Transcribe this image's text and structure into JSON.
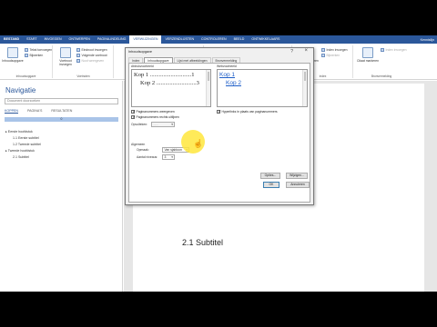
{
  "ribbon": {
    "tabs": [
      "BESTAND",
      "START",
      "INVOEGEN",
      "ONTWERPEN",
      "PAGINA-INDELING",
      "VERWIJZINGEN",
      "VERZENDLIJSTEN",
      "CONTROLEREN",
      "BEELD",
      "ONTWIKKELAARS"
    ],
    "active_tab": "VERWIJZINGEN",
    "user": "Kennislijn",
    "groups": {
      "toc": {
        "big": "Inhoudsopgave",
        "small": [
          "Tekst toevoegen",
          "Bijwerken"
        ],
        "label": "Inhoudsopgave"
      },
      "footnotes": {
        "big": "Voetnoot invoegen",
        "small": [
          "Eindnoot invoegen",
          "Volgende voetnoot",
          "Noot weergeven"
        ],
        "label": "Voetnoten"
      },
      "citations": {
        "big": "Citaat invoegen",
        "small": [
          "Bronnen beheren",
          "Stijl: APA",
          "Bibliografie"
        ],
        "label": "Citaten en bibliografie"
      },
      "captions": {
        "big": "Bijschrift invoegen",
        "small": [
          "Lijst met afbeeldingen invoegen",
          "Bijwerken",
          "Kruisverwijzing"
        ],
        "label": "Bijschriften"
      },
      "index": {
        "big": "Item markeren",
        "small": [
          "Index invoegen",
          "Bijwerken"
        ],
        "label": "Index"
      },
      "authorities": {
        "big": "Citaat markeren",
        "small": [
          "Index invoegen"
        ],
        "label": "Bronvermelding"
      }
    }
  },
  "nav": {
    "title": "Navigatie",
    "search_placeholder": "Document doorzoeken",
    "tabs": [
      "KOPPEN",
      "PAGINA'S",
      "RESULTATEN"
    ],
    "bar": "0",
    "tree": [
      "▸ Eerste hoofdstuk",
      "1.1 Eerste subtitel",
      "1.2 Tweede subtitel",
      "▸ Tweede hoofdstuk",
      "2.1 Subtitel"
    ]
  },
  "document": {
    "visible_heading": "2.1 Subtitel"
  },
  "dialog": {
    "title": "Inhoudsopgave",
    "tabs": [
      "Index",
      "Inhoudsopgave",
      "Lijst met afbeeldingen",
      "Bronvermelding"
    ],
    "active_tab": "Inhoudsopgave",
    "print_preview_label": "Afdrukvoorbeeld",
    "web_preview_label": "Webvoorbeeld",
    "print_preview_lines": [
      "Kop 1 ............................1",
      "Kop 2 ...........................3"
    ],
    "web_preview_lines": [
      "Kop 1",
      "Kop 2"
    ],
    "options": {
      "show_page_numbers": "Paginanummers weergeven",
      "right_align": "Paginanummers rechts uitlijnen",
      "tab_leader_label": "Opvulteken:",
      "tab_leader_value": "......",
      "use_hyperlinks": "Hyperlinks in plaats van paginanummers"
    },
    "general_label": "Algemeen",
    "formats_label": "Opmaak:",
    "formats_value": "Van sjabloon",
    "levels_label": "Aantal niveaus:",
    "levels_value": "3",
    "buttons": {
      "options": "Opties...",
      "modify": "Wijzigen...",
      "ok": "OK",
      "cancel": "Annuleren"
    }
  }
}
